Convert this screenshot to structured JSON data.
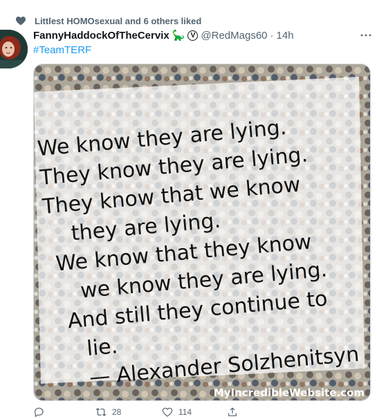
{
  "social_context": {
    "text": "Littlest HOMOsexual and 6 others liked",
    "icon": "heart-icon"
  },
  "tweet": {
    "display_name": "FannyHaddockOfTheCervix",
    "name_emoji": "🦕",
    "name_badge": "V",
    "handle": "@RedMags60",
    "separator": "·",
    "time": "14h",
    "hashtag": "#TeamTERF"
  },
  "media": {
    "quote_lines": [
      "We know they are lying.",
      "They know they are lying.",
      "They know that we know",
      "they are lying.",
      "We know that they know",
      "we know they are lying.",
      "And still they continue to",
      "lie.",
      "— Alexander Solzhenitsyn"
    ],
    "watermark": "MyIncredibleWebsite.com"
  },
  "actions": {
    "reply_count": "",
    "retweet_count": "28",
    "like_count": "114"
  },
  "colors": {
    "accent": "#1d9bf0",
    "secondary_text": "#536471",
    "heart": "#536471"
  }
}
